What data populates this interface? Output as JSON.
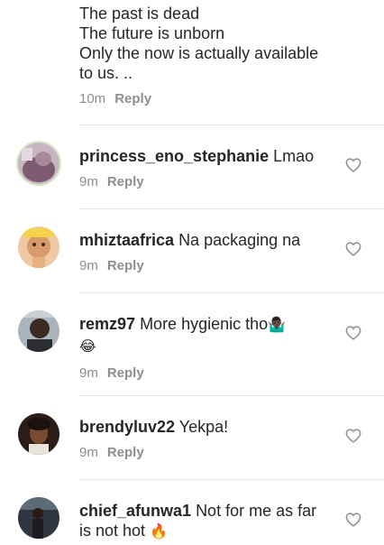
{
  "top_comment": {
    "text": "The past is dead\nThe future is unborn\nOnly the now is actually available\nto us. ..",
    "time": "10m",
    "reply_label": "Reply"
  },
  "comments": [
    {
      "username": "princess_eno_stephanie",
      "text": "Lmao",
      "time": "9m",
      "reply_label": "Reply",
      "avatar": "avatar-photo-1"
    },
    {
      "username": "mhiztaafrica",
      "text": "Na packaging na",
      "time": "9m",
      "reply_label": "Reply",
      "avatar": "avatar-photo-2"
    },
    {
      "username": "remz97",
      "text": "More hygienic tho",
      "emoji_inline": "🤷🏿‍♂️",
      "emoji_second_line": "😂",
      "time": "9m",
      "reply_label": "Reply",
      "avatar": "avatar-photo-3"
    },
    {
      "username": "brendyluv22",
      "text": "Yekpa!",
      "time": "9m",
      "reply_label": "Reply",
      "avatar": "avatar-photo-4"
    },
    {
      "username": "chief_afunwa1",
      "text": "Not for me as far",
      "text_line2": "is not hot",
      "emoji_inline": "🔥",
      "avatar": "avatar-photo-5"
    }
  ],
  "icons": {
    "like": "heart-outline-icon"
  },
  "colors": {
    "text": "#262626",
    "meta": "#8e8e8e",
    "divider": "#e6e6e6"
  }
}
